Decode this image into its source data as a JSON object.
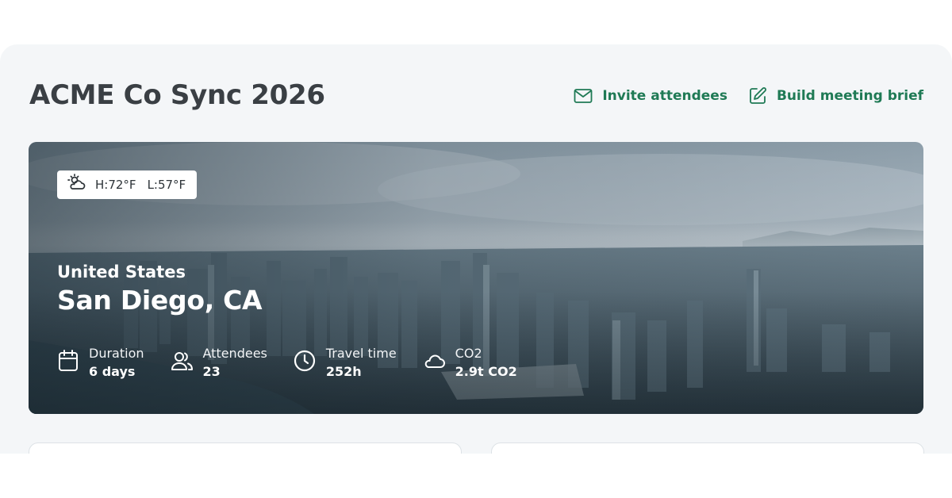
{
  "page": {
    "title": "ACME Co Sync 2026",
    "actions": [
      {
        "label": "Invite attendees",
        "icon": "envelope-icon"
      },
      {
        "label": "Build meeting brief",
        "icon": "edit-icon"
      }
    ],
    "accent_color": "#1f7a55"
  },
  "hero": {
    "weather": {
      "icon": "partly-cloudy-icon",
      "high": "H:72°F",
      "low": "L:57°F"
    },
    "country": "United States",
    "city": "San Diego, CA",
    "stats": [
      {
        "icon": "calendar-icon",
        "label": "Duration",
        "value": "6 days"
      },
      {
        "icon": "users-icon",
        "label": "Attendees",
        "value": "23"
      },
      {
        "icon": "clock-icon",
        "label": "Travel time",
        "value": "252h"
      },
      {
        "icon": "cloud-icon",
        "label": "CO2",
        "value": "2.9t CO2"
      }
    ]
  }
}
